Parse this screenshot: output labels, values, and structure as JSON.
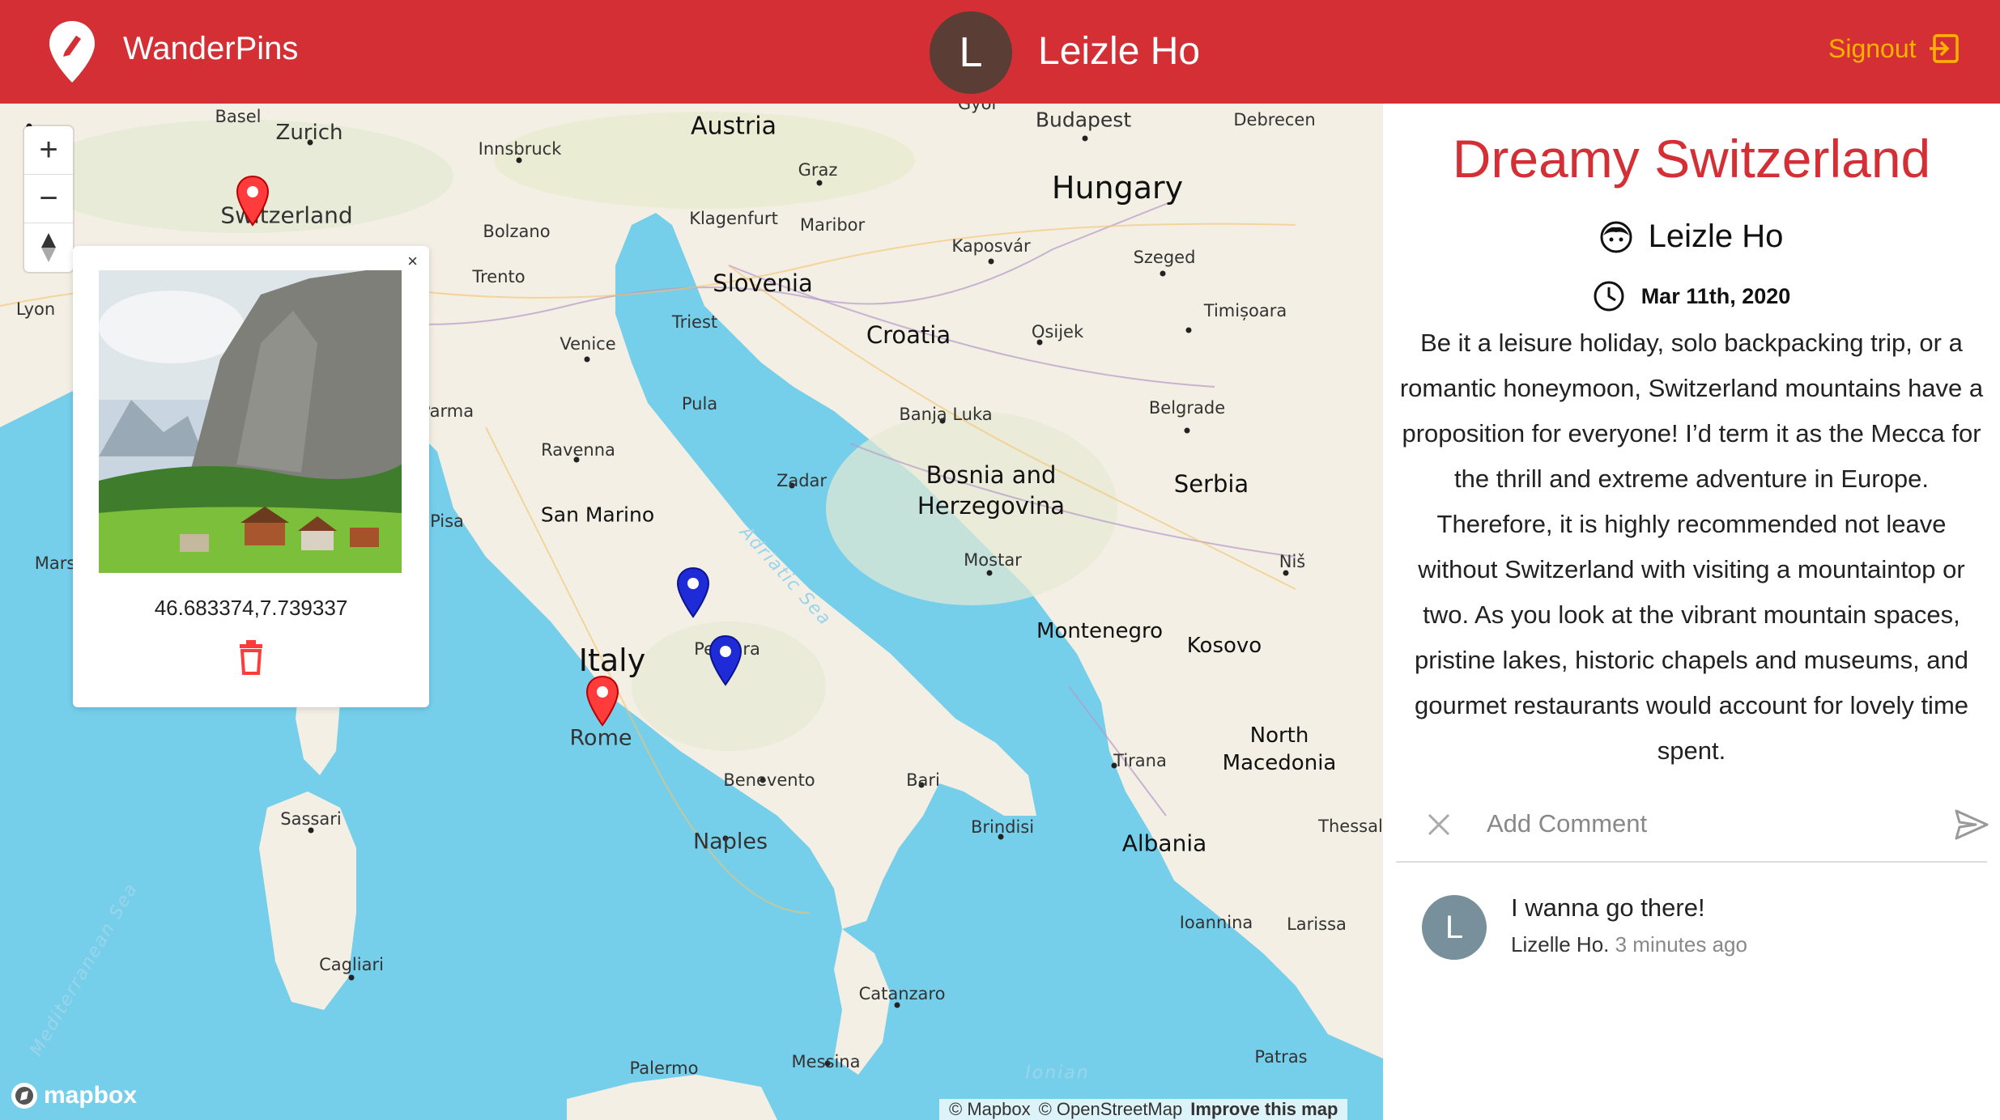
{
  "app": {
    "brand": "WanderPins"
  },
  "header": {
    "user_initial": "L",
    "user_name": "Leizle Ho",
    "signout_label": "Signout"
  },
  "map": {
    "zoom_in": "+",
    "zoom_out": "−",
    "labels": {
      "basel": "Basel",
      "zurich": "Zurich",
      "innsbruck": "Innsbruck",
      "austria": "Austria",
      "graz": "Graz",
      "budapest": "Budapest",
      "debrecen": "Debrecen",
      "gyor": "Győr",
      "hungary": "Hungary",
      "switzerland": "Switzerland",
      "bolzano": "Bolzano",
      "klagenfurt": "Klagenfurt",
      "maribor": "Maribor",
      "kaposvar": "Kaposvár",
      "szeged": "Szeged",
      "trento": "Trento",
      "slovenia": "Slovenia",
      "lyon": "Lyon",
      "timisoara": "Timișoara",
      "triest": "Triest",
      "venice": "Venice",
      "croatia": "Croatia",
      "osijek": "Osijek",
      "parma": "Parma",
      "pula": "Pula",
      "banja_luka": "Banja Luka",
      "belgrade": "Belgrade",
      "ravenna": "Ravenna",
      "zadar": "Zadar",
      "bosnia": "Bosnia and\nHerzegovina",
      "serbia": "Serbia",
      "san_marino": "San Marino",
      "pisa": "Pisa",
      "mars": "Mars",
      "adriatic": "Adriatic Sea",
      "mostar": "Mostar",
      "nis": "Niš",
      "montenegro": "Montenegro",
      "kosovo": "Kosovo",
      "italy": "Italy",
      "pescara": "Pescara",
      "rome": "Rome",
      "north_macedonia": "North\nMacedonia",
      "tirana": "Tirana",
      "benevento": "Benevento",
      "bari": "Bari",
      "sassari": "Sassari",
      "brindisi": "Brindisi",
      "naples": "Naples",
      "albania": "Albania",
      "thessal": "Thessal",
      "ioannina": "Ioannina",
      "larissa": "Larissa",
      "mediterranean": "Mediterranean Sea",
      "cagliari": "Cagliari",
      "catanzaro": "Catanzaro",
      "palermo": "Palermo",
      "messina": "Messina",
      "ionian": "Ionian",
      "patras": "Patras"
    },
    "popup": {
      "close": "×",
      "coords": "46.683374,7.739337"
    },
    "mapbox_logo": "mapbox",
    "attribution": {
      "mapbox": "© Mapbox",
      "osm": "© OpenStreetMap",
      "improve": "Improve this map"
    },
    "colors": {
      "land": "#f3efe4",
      "water": "#75cfeb",
      "pin_red": "#ff3b3b",
      "pin_blue": "#1e2bd6"
    }
  },
  "post": {
    "title": "Dreamy Switzerland",
    "author": "Leizle Ho",
    "date": "Mar 11th, 2020",
    "body": "Be it a leisure holiday, solo backpacking trip, or a romantic honeymoon, Switzerland mountains have a proposition for everyone! I’d term it as the Mecca for the thrill and extreme adventure in Europe. Therefore, it is highly recommended not leave without Switzerland with visiting a mountaintop or two. As you look at the vibrant mountain spaces, pristine lakes, historic chapels and museums, and gourmet restaurants would account for lovely time spent.",
    "comment_placeholder": "Add Comment"
  },
  "comments": [
    {
      "initial": "L",
      "text": "I wanna go there!",
      "author": "Lizelle Ho",
      "time": "3 minutes ago"
    }
  ],
  "theme": {
    "primary": "#d32f34",
    "accent": "#ffb300"
  }
}
